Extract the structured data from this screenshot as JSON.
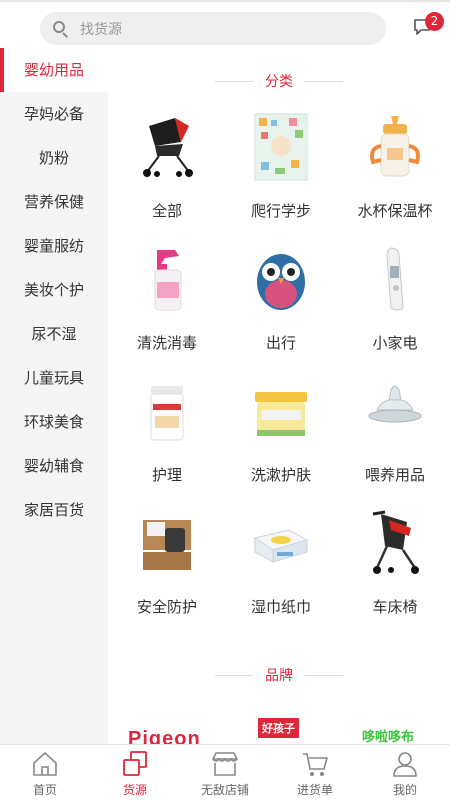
{
  "search": {
    "placeholder": "找货源"
  },
  "messages": {
    "badge": "2"
  },
  "sidebar": {
    "items": [
      {
        "label": "婴幼用品",
        "active": true
      },
      {
        "label": "孕妈必备"
      },
      {
        "label": "奶粉"
      },
      {
        "label": "营养保健"
      },
      {
        "label": "婴童服纺"
      },
      {
        "label": "美妆个护"
      },
      {
        "label": "尿不湿"
      },
      {
        "label": "儿童玩具"
      },
      {
        "label": "环球美食"
      },
      {
        "label": "婴幼辅食"
      },
      {
        "label": "家居百货"
      }
    ]
  },
  "content": {
    "category_title": "分类",
    "brand_title": "品牌",
    "categories": [
      {
        "label": "全部",
        "icon": "stroller-icon"
      },
      {
        "label": "爬行学步",
        "icon": "play-mat-icon"
      },
      {
        "label": "水杯保温杯",
        "icon": "sippy-cup-icon"
      },
      {
        "label": "清洗消毒",
        "icon": "spray-bottle-icon"
      },
      {
        "label": "出行",
        "icon": "owl-backpack-icon"
      },
      {
        "label": "小家电",
        "icon": "ear-thermometer-icon"
      },
      {
        "label": "护理",
        "icon": "cotton-jar-icon"
      },
      {
        "label": "洗漱护肤",
        "icon": "cream-jar-icon"
      },
      {
        "label": "喂养用品",
        "icon": "nipple-icon"
      },
      {
        "label": "安全防护",
        "icon": "drawer-lock-icon"
      },
      {
        "label": "湿巾纸巾",
        "icon": "wipes-pack-icon"
      },
      {
        "label": "车床椅",
        "icon": "stroller-icon"
      }
    ],
    "brands": [
      "Pigeon",
      "好孩子",
      "哆啦哆布"
    ]
  },
  "tabbar": {
    "items": [
      {
        "label": "首页",
        "icon": "home-icon"
      },
      {
        "label": "货源",
        "icon": "layers-icon",
        "active": true
      },
      {
        "label": "无敌店铺",
        "icon": "store-icon"
      },
      {
        "label": "进货单",
        "icon": "cart-icon"
      },
      {
        "label": "我的",
        "icon": "user-icon"
      }
    ]
  },
  "colors": {
    "accent": "#e0263a",
    "sidebar_bg": "#f5f5f5"
  }
}
